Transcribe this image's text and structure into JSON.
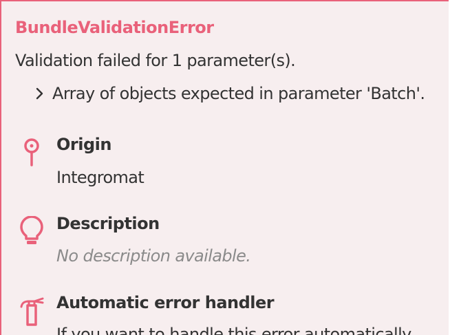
{
  "error": {
    "name": "BundleValidationError",
    "summary": "Validation failed for 1 parameter(s).",
    "details": [
      "Array of objects expected in parameter 'Batch'."
    ]
  },
  "sections": {
    "origin": {
      "heading": "Origin",
      "text": "Integromat",
      "icon": "pin-icon"
    },
    "description": {
      "heading": "Description",
      "text": "No description available.",
      "icon": "lightbulb-icon"
    },
    "handler": {
      "heading": "Automatic error handler",
      "text": "If you want to handle this error automatically,",
      "icon": "fire-extinguisher-icon"
    }
  },
  "colors": {
    "accent": "#e9617a",
    "background": "#f7eeef",
    "text": "#333333",
    "muted": "#8a8a8a"
  }
}
